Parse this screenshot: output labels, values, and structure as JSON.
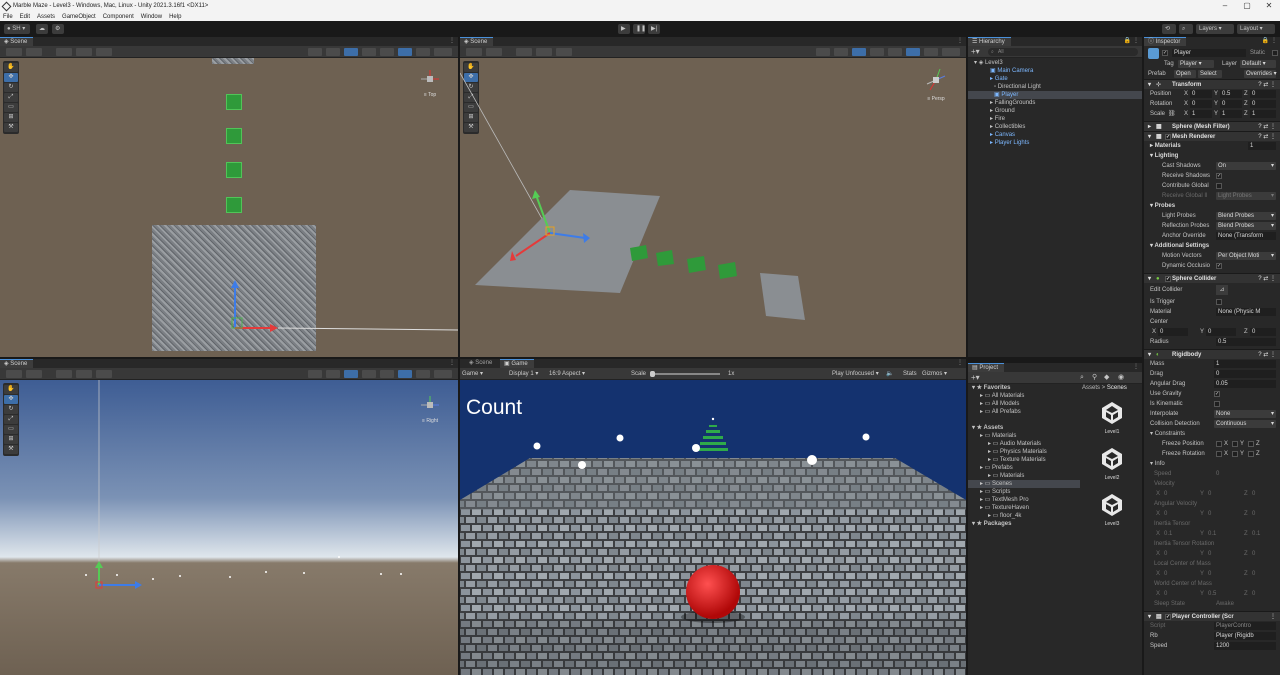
{
  "window": {
    "title": "Marble Maze - Level3 - Windows, Mac, Linux - Unity 2021.3.16f1 <DX11>"
  },
  "menu": [
    "File",
    "Edit",
    "Assets",
    "GameObject",
    "Component",
    "Window",
    "Help"
  ],
  "toolbar": {
    "account": "SH",
    "layers": "Layers",
    "layout": "Layout"
  },
  "scene_top_left": {
    "tab": "Scene",
    "gizmo_label": "Top"
  },
  "scene_top_right": {
    "tab": "Scene",
    "gizmo_label": "Persp"
  },
  "scene_bottom_left": {
    "tab": "Scene",
    "gizmo_label": "Right"
  },
  "game": {
    "tabs": [
      "Scene",
      "Game"
    ],
    "mode": "Game",
    "display": "Display 1",
    "aspect": "16:9 Aspect",
    "scale_label": "Scale",
    "scale_value": "1x",
    "play_mode": "Play Unfocused",
    "stats": "Stats",
    "gizmos": "Gizmos",
    "count_text": "Count"
  },
  "hierarchy": {
    "tab": "Hierarchy",
    "search": "All",
    "root": "Level3",
    "items": [
      "Main Camera",
      "Gate",
      "Directional Light",
      "Player",
      "FallingGrounds",
      "Ground",
      "Fire",
      "Collectibles",
      "Canvas",
      "Player Lights"
    ]
  },
  "project": {
    "tab": "Project",
    "breadcrumb": [
      "Assets",
      "Scenes"
    ],
    "tree": [
      {
        "label": "Favorites",
        "bold": true,
        "indent": 0
      },
      {
        "label": "All Materials",
        "indent": 1
      },
      {
        "label": "All Models",
        "indent": 1
      },
      {
        "label": "All Prefabs",
        "indent": 1
      },
      {
        "label": "",
        "indent": 0
      },
      {
        "label": "Assets",
        "bold": true,
        "indent": 0
      },
      {
        "label": "Materials",
        "indent": 1
      },
      {
        "label": "Audio Materials",
        "indent": 2
      },
      {
        "label": "Physics Materials",
        "indent": 2
      },
      {
        "label": "Texture Materials",
        "indent": 2
      },
      {
        "label": "Prefabs",
        "indent": 1
      },
      {
        "label": "Materials",
        "indent": 2
      },
      {
        "label": "Scenes",
        "indent": 1,
        "selected": true
      },
      {
        "label": "Scripts",
        "indent": 1
      },
      {
        "label": "TextMesh Pro",
        "indent": 1
      },
      {
        "label": "TextureHaven",
        "indent": 1
      },
      {
        "label": "floor_4k",
        "indent": 2
      },
      {
        "label": "Packages",
        "bold": true,
        "indent": 0
      }
    ],
    "assets": [
      "Level1",
      "Level2",
      "Level3"
    ]
  },
  "inspector": {
    "tab": "Inspector",
    "name": "Player",
    "static": "Static",
    "tag_label": "Tag",
    "tag": "Player",
    "layer_label": "Layer",
    "layer": "Default",
    "prefab_label": "Prefab",
    "open": "Open",
    "select": "Select",
    "overrides": "Overrides",
    "transform": {
      "title": "Transform",
      "position_label": "Position",
      "position": [
        "0",
        "0.5",
        "0"
      ],
      "rotation_label": "Rotation",
      "rotation": [
        "0",
        "0",
        "0"
      ],
      "scale_label": "Scale",
      "scale": [
        "1",
        "1",
        "1"
      ]
    },
    "mesh_filter": "Sphere (Mesh Filter)",
    "mesh_renderer": {
      "title": "Mesh Renderer",
      "materials": "Materials",
      "materials_count": "1",
      "lighting": "Lighting",
      "cast_shadows": "Cast Shadows",
      "cast_shadows_val": "On",
      "receive_shadows": "Receive Shadows",
      "contribute_gi": "Contribute Global",
      "receive_gi": "Receive Global Il",
      "receive_gi_val": "Light Probes",
      "probes": "Probes",
      "light_probes": "Light Probes",
      "light_probes_val": "Blend Probes",
      "reflection_probes": "Reflection Probes",
      "reflection_probes_val": "Blend Probes",
      "anchor_override": "Anchor Override",
      "anchor_override_val": "None (Transform",
      "additional": "Additional Settings",
      "motion_vectors": "Motion Vectors",
      "motion_vectors_val": "Per Object Moti",
      "dynamic_occlusion": "Dynamic Occlusio"
    },
    "sphere_collider": {
      "title": "Sphere Collider",
      "edit_collider": "Edit Collider",
      "is_trigger": "Is Trigger",
      "material": "Material",
      "material_val": "None (Physic M",
      "center": "Center",
      "center_val": [
        "0",
        "0",
        "0"
      ],
      "radius": "Radius",
      "radius_val": "0.5"
    },
    "rigidbody": {
      "title": "Rigidbody",
      "mass": "Mass",
      "mass_val": "1",
      "drag": "Drag",
      "drag_val": "0",
      "angular_drag": "Angular Drag",
      "angular_drag_val": "0.05",
      "use_gravity": "Use Gravity",
      "is_kinematic": "Is Kinematic",
      "interpolate": "Interpolate",
      "interpolate_val": "None",
      "collision_detection": "Collision Detection",
      "collision_detection_val": "Continuous",
      "constraints": "Constraints",
      "freeze_position": "Freeze Position",
      "freeze_rotation": "Freeze Rotation",
      "info": "Info",
      "speed": "Speed",
      "speed_val": "0",
      "velocity": "Velocity",
      "velocity_val": [
        "0",
        "0",
        "0"
      ],
      "angular_velocity": "Angular Velocity",
      "angular_velocity_val": [
        "0",
        "0",
        "0"
      ],
      "inertia_tensor": "Inertia Tensor",
      "inertia_tensor_val": [
        "0.1",
        "0.1",
        "0.1"
      ],
      "inertia_tensor_rot": "Inertia Tensor Rotation",
      "inertia_tensor_rot_val": [
        "0",
        "0",
        "0"
      ],
      "local_com": "Local Center of Mass",
      "local_com_val": [
        "0",
        "0",
        "0"
      ],
      "world_com": "World Center of Mass",
      "world_com_val": [
        "0",
        "0.5",
        "0"
      ],
      "sleep_state": "Sleep State",
      "sleep_state_val": "Awake"
    },
    "player_controller": {
      "title": "Player Controller (Scr",
      "script": "Script",
      "script_val": "PlayerContro",
      "rb": "Rb",
      "rb_val": "Player (Rigidb",
      "speed": "Speed",
      "speed_val": "1200"
    }
  }
}
